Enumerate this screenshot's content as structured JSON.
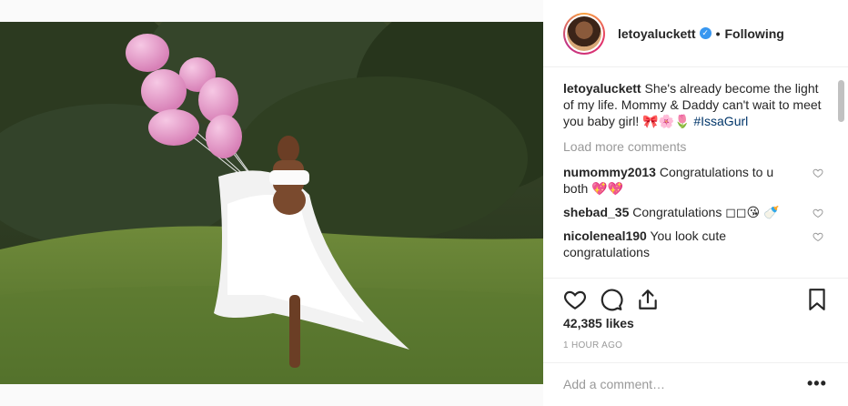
{
  "post": {
    "username": "letoyaluckett",
    "verified_icon": "verified-badge-icon",
    "separator": "•",
    "follow_status": "Following"
  },
  "caption": {
    "username": "letoyaluckett",
    "text": "She's already become the light of my life. Mommy & Daddy can't wait to meet you baby girl! 🎀🌸🌷",
    "hashtag": "#IssaGurl"
  },
  "load_more": "Load more comments",
  "comments": [
    {
      "username": "numommy2013",
      "text": "Congratulations to u both 💖💖"
    },
    {
      "username": "shebad_35",
      "text": "Congratulations ◻◻😘 🍼"
    },
    {
      "username": "nicoleneal190",
      "text": "You look cute congratulations"
    }
  ],
  "likes": "42,385 likes",
  "timestamp": "1 HOUR AGO",
  "add_comment": {
    "placeholder": "Add a comment…"
  },
  "more_label": "•••",
  "colors": {
    "accent": "#3897f0",
    "muted": "#999999",
    "hashtag": "#003569"
  }
}
